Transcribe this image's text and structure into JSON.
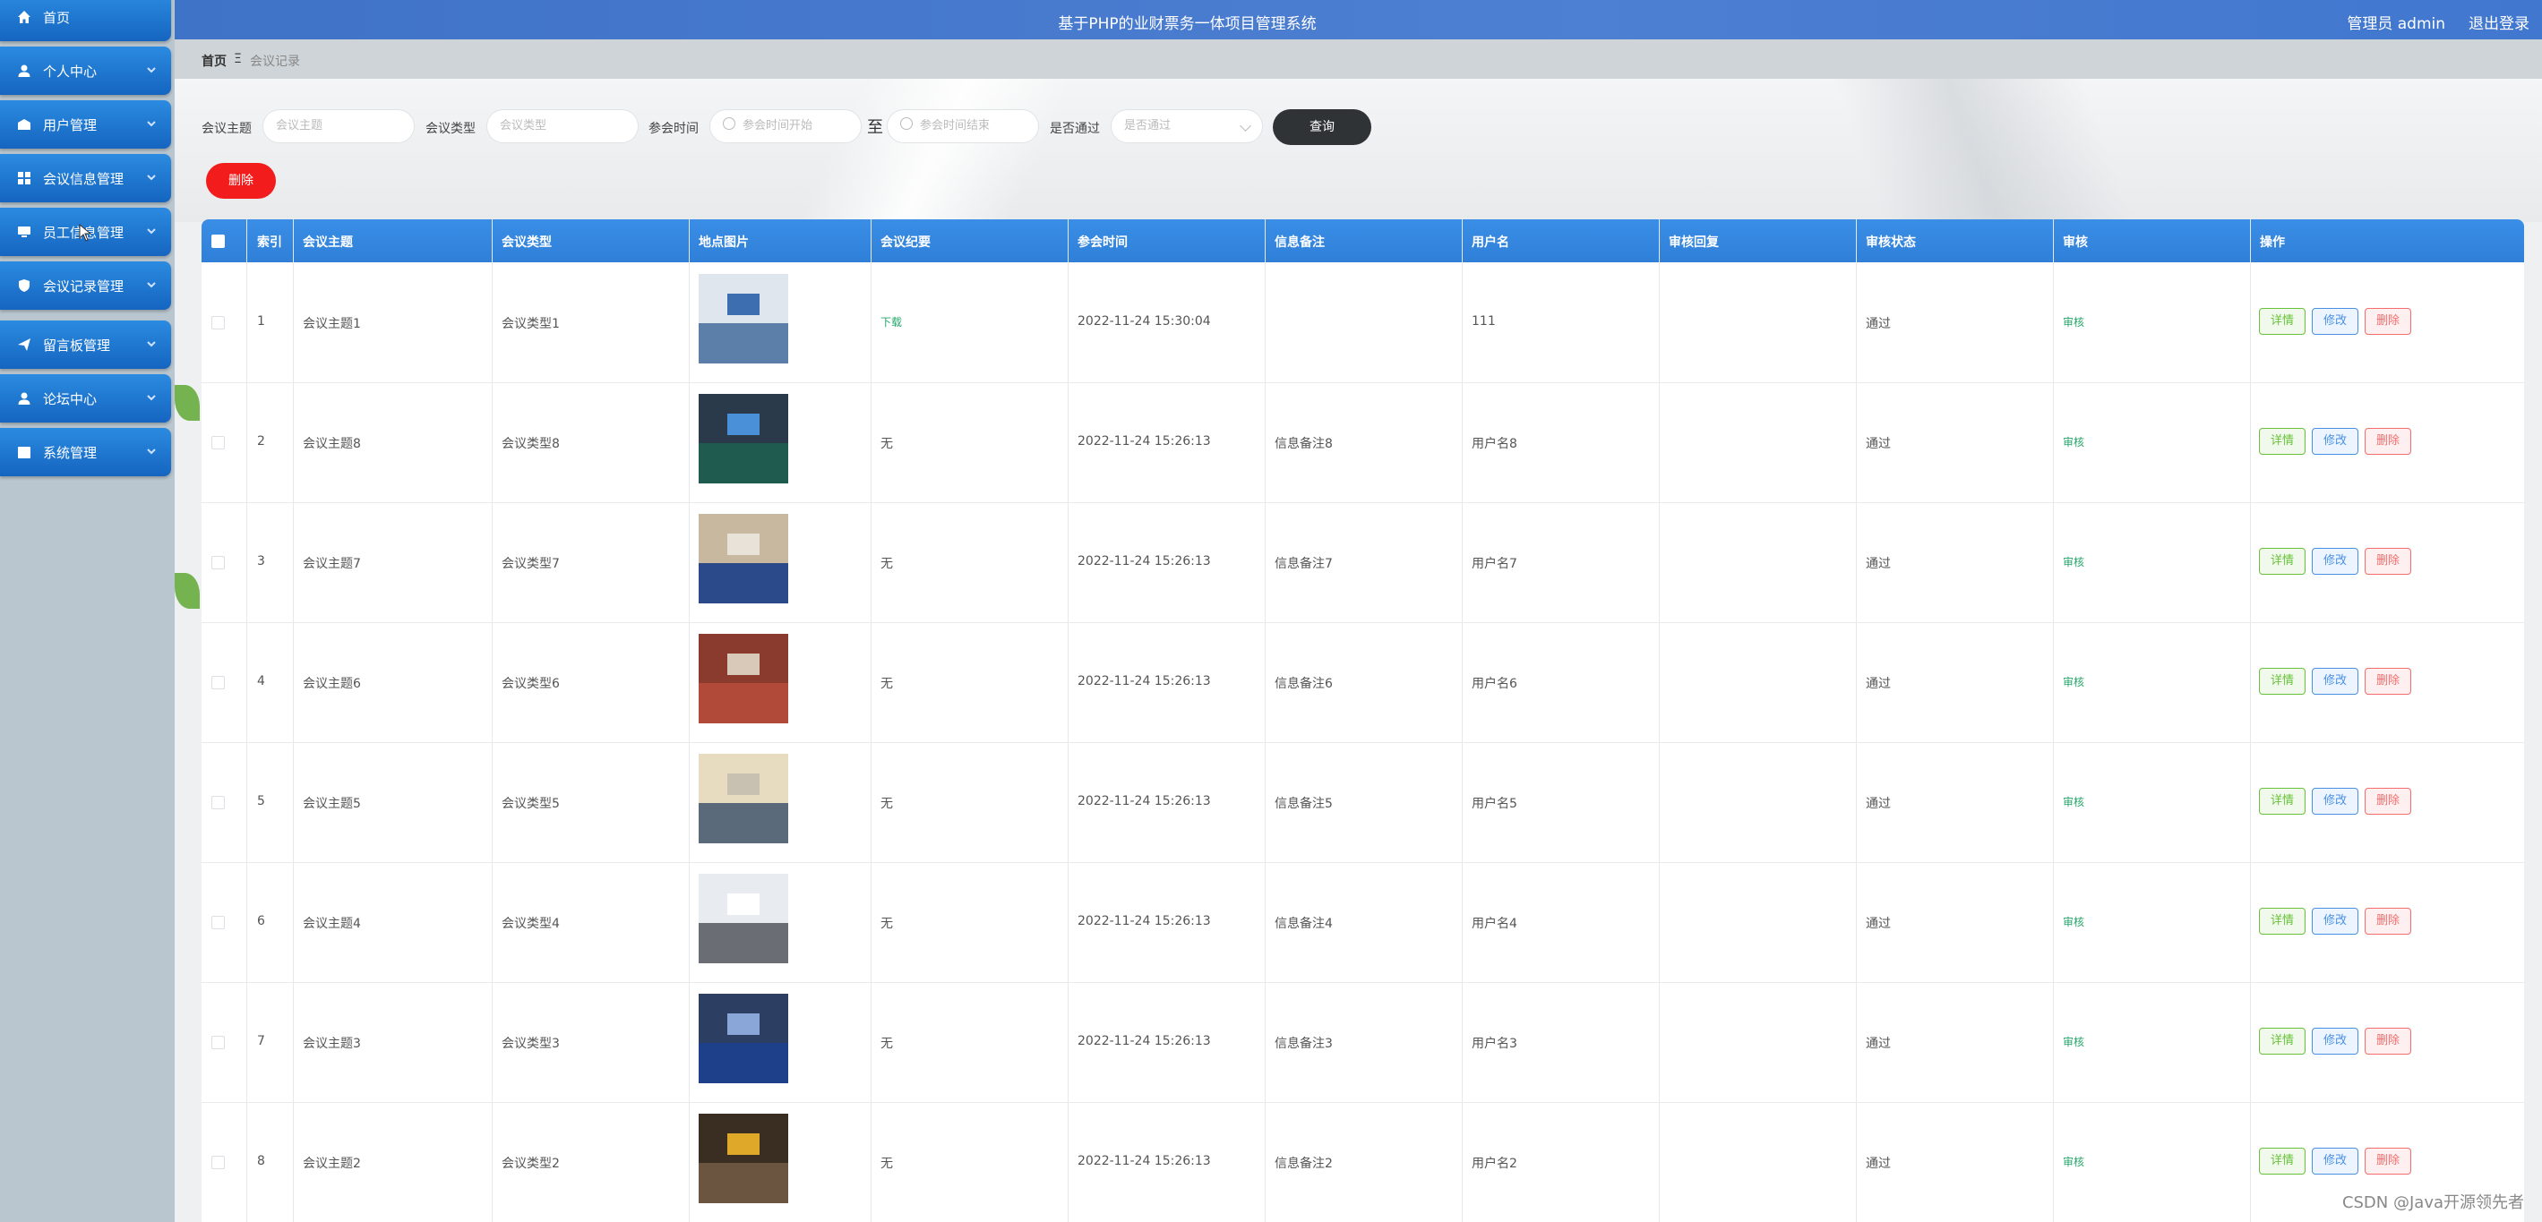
{
  "app": {
    "title": "基于PHP的业财票务一体项目管理系统",
    "user": "管理员 admin",
    "logout": "退出登录"
  },
  "breadcrumb": {
    "home": "首页",
    "separator": "Ξ",
    "current": "会议记录"
  },
  "sidebar": {
    "items": [
      {
        "label": "首页",
        "icon": "home-icon"
      },
      {
        "label": "个人中心",
        "icon": "user-icon"
      },
      {
        "label": "用户管理",
        "icon": "building-icon"
      },
      {
        "label": "会议信息管理",
        "icon": "grid-icon"
      },
      {
        "label": "员工信息管理",
        "icon": "monitor-icon"
      },
      {
        "label": "会议记录管理",
        "icon": "shield-icon"
      },
      {
        "label": "留言板管理",
        "icon": "send-icon"
      },
      {
        "label": "论坛中心",
        "icon": "user-icon"
      },
      {
        "label": "系统管理",
        "icon": "calendar-icon"
      }
    ]
  },
  "search": {
    "topic_label": "会议主题",
    "topic_placeholder": "会议主题",
    "type_label": "会议类型",
    "type_placeholder": "会议类型",
    "time_label": "参会时间",
    "time_start_placeholder": "参会时间开始",
    "to": "至",
    "time_end_placeholder": "参会时间结束",
    "pass_label": "是否通过",
    "pass_placeholder": "是否通过",
    "query_button": "查询",
    "delete_button": "删除"
  },
  "table": {
    "headers": [
      "索引",
      "会议主题",
      "会议类型",
      "地点图片",
      "会议纪要",
      "参会时间",
      "信息备注",
      "用户名",
      "审核回复",
      "审核状态",
      "审核",
      "操作"
    ],
    "actions": {
      "detail": "详情",
      "edit": "修改",
      "remove": "删除"
    },
    "review_link": "审核",
    "rows": [
      {
        "index": "1",
        "topic": "会议主题1",
        "type": "会议类型1",
        "minutes": "下载",
        "time": "2022-11-24 15:30:04",
        "note": "",
        "user": "111",
        "reply": "",
        "status": "通过"
      },
      {
        "index": "2",
        "topic": "会议主题8",
        "type": "会议类型8",
        "minutes": "无",
        "time": "2022-11-24 15:26:13",
        "note": "信息备注8",
        "user": "用户名8",
        "reply": "",
        "status": "通过"
      },
      {
        "index": "3",
        "topic": "会议主题7",
        "type": "会议类型7",
        "minutes": "无",
        "time": "2022-11-24 15:26:13",
        "note": "信息备注7",
        "user": "用户名7",
        "reply": "",
        "status": "通过"
      },
      {
        "index": "4",
        "topic": "会议主题6",
        "type": "会议类型6",
        "minutes": "无",
        "time": "2022-11-24 15:26:13",
        "note": "信息备注6",
        "user": "用户名6",
        "reply": "",
        "status": "通过"
      },
      {
        "index": "5",
        "topic": "会议主题5",
        "type": "会议类型5",
        "minutes": "无",
        "time": "2022-11-24 15:26:13",
        "note": "信息备注5",
        "user": "用户名5",
        "reply": "",
        "status": "通过"
      },
      {
        "index": "6",
        "topic": "会议主题4",
        "type": "会议类型4",
        "minutes": "无",
        "time": "2022-11-24 15:26:13",
        "note": "信息备注4",
        "user": "用户名4",
        "reply": "",
        "status": "通过"
      },
      {
        "index": "7",
        "topic": "会议主题3",
        "type": "会议类型3",
        "minutes": "无",
        "time": "2022-11-24 15:26:13",
        "note": "信息备注3",
        "user": "用户名3",
        "reply": "",
        "status": "通过"
      },
      {
        "index": "8",
        "topic": "会议主题2",
        "type": "会议类型2",
        "minutes": "无",
        "time": "2022-11-24 15:26:13",
        "note": "信息备注2",
        "user": "用户名2",
        "reply": "",
        "status": "通过"
      }
    ]
  },
  "watermark": "CSDN @Java开源领先者",
  "colors": {
    "primary": "#2f7fd8",
    "danger": "#f21c1c",
    "success": "#27a56b"
  }
}
